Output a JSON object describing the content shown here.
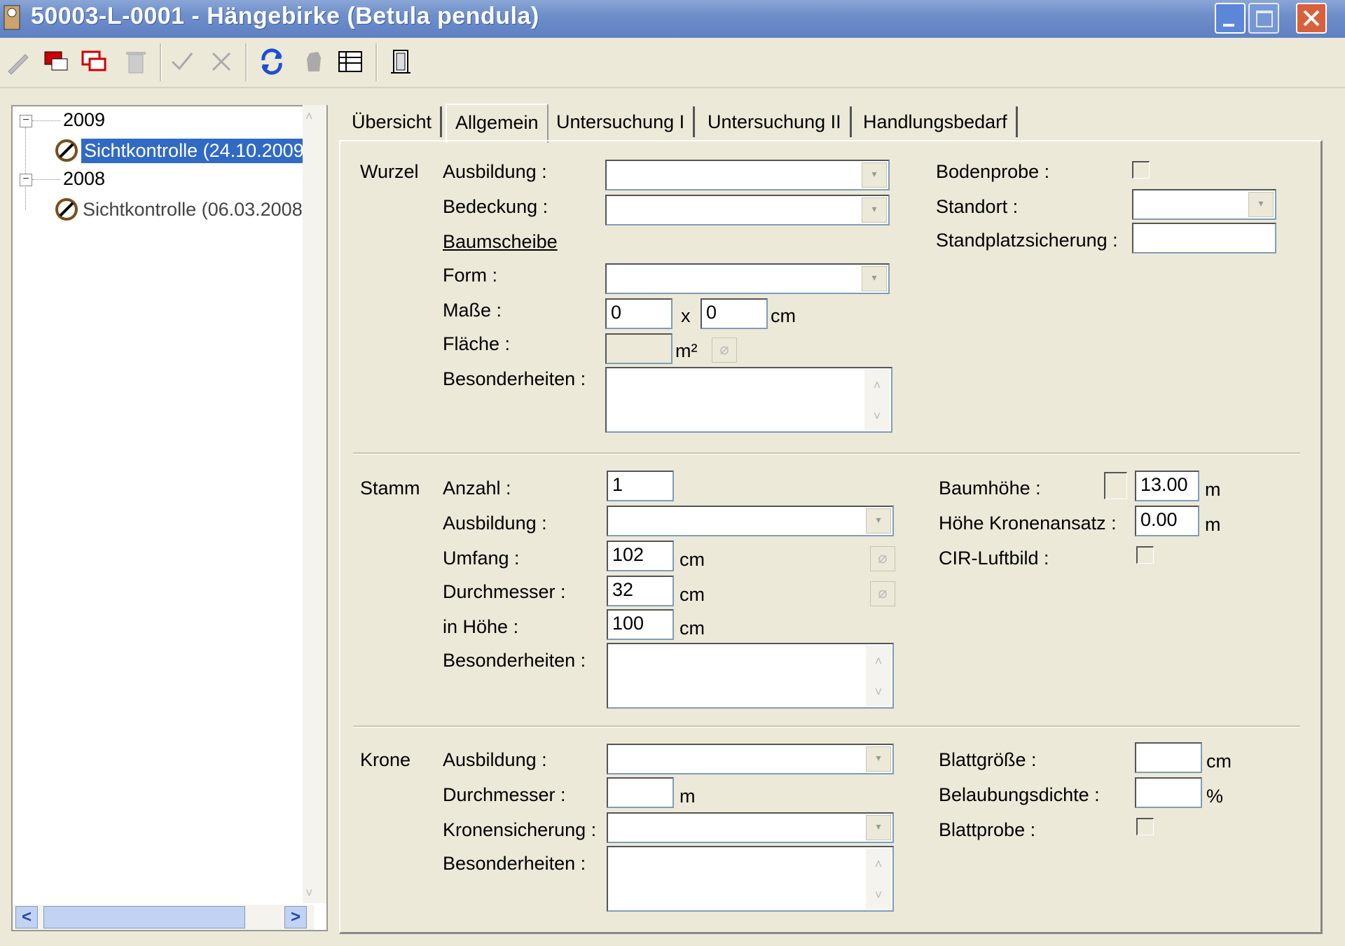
{
  "window": {
    "title": "50003-L-0001  -  Hängebirke (Betula pendula)"
  },
  "tree": {
    "nodes": [
      {
        "year": "2009",
        "item": "Sichtkontrolle (24.10.2009"
      },
      {
        "year": "2008",
        "item": "Sichtkontrolle (06.03.2008"
      }
    ],
    "expand_symbol": "⊟"
  },
  "tabs": [
    "Übersicht",
    "Allgemein",
    "Untersuchung I",
    "Untersuchung II",
    "Handlungsbedarf"
  ],
  "wurzel": {
    "section": "Wurzel",
    "ausbildung_label": "Ausbildung :",
    "bedeckung_label": "Bedeckung :",
    "baumscheibe_label": "Baumscheibe",
    "form_label": "Form :",
    "masse_label": "Maße :",
    "masse_a": "0",
    "masse_x": "x",
    "masse_b": "0",
    "masse_unit": "cm",
    "flaeche_label": "Fläche :",
    "flaeche_unit": "m²",
    "besonderheiten_label": "Besonderheiten :",
    "bodenprobe_label": "Bodenprobe :",
    "standort_label": "Standort :",
    "standplatz_label": "Standplatzsicherung :"
  },
  "stamm": {
    "section": "Stamm",
    "anzahl_label": "Anzahl :",
    "anzahl_value": "1",
    "ausbildung_label": "Ausbildung :",
    "umfang_label": "Umfang :",
    "umfang_value": "102",
    "umfang_unit": "cm",
    "durchmesser_label": "Durchmesser :",
    "durchmesser_value": "32",
    "durchmesser_unit": "cm",
    "hoehe_label": "in Höhe :",
    "hoehe_value": "100",
    "hoehe_unit": "cm",
    "besonderheiten_label": "Besonderheiten :",
    "baumhoehe_label": "Baumhöhe :",
    "baumhoehe_value": "13.00",
    "baumhoehe_unit": "m",
    "kronenansatz_label": "Höhe Kronenansatz :",
    "kronenansatz_value": "0.00",
    "kronenansatz_unit": "m",
    "cir_label": "CIR-Luftbild :"
  },
  "krone": {
    "section": "Krone",
    "ausbildung_label": "Ausbildung :",
    "durchmesser_label": "Durchmesser :",
    "durchmesser_unit": "m",
    "kronensicherung_label": "Kronensicherung :",
    "besonderheiten_label": "Besonderheiten :",
    "blattgroesse_label": "Blattgröße :",
    "blattgroesse_unit": "cm",
    "belaubung_label": "Belaubungsdichte :",
    "belaubung_unit": "%",
    "blattprobe_label": "Blattprobe :"
  },
  "icons": {
    "calc": "⌀",
    "up": "˄",
    "down": "˅",
    "drop": "▾",
    "left": "<",
    "right": ">"
  }
}
